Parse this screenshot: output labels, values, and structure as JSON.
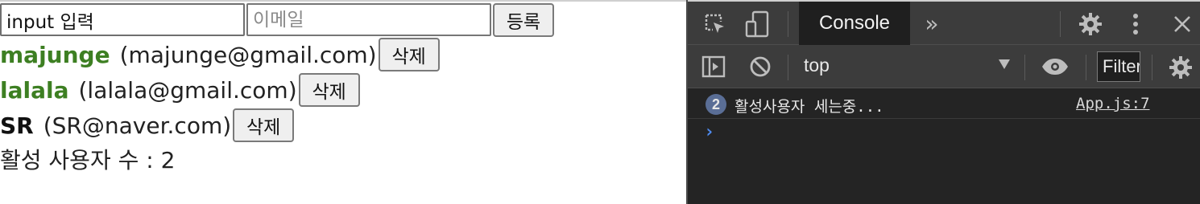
{
  "form": {
    "username_value": "input 입력",
    "email_placeholder": "이메일",
    "email_value": "",
    "register_label": "등록"
  },
  "users": [
    {
      "username": "majunge",
      "email_display": "(majunge@gmail.com)",
      "active": true,
      "delete_label": "삭제"
    },
    {
      "username": "lalala",
      "email_display": "(lalala@gmail.com)",
      "active": true,
      "delete_label": "삭제"
    },
    {
      "username": "SR",
      "email_display": "(SR@naver.com)",
      "active": false,
      "delete_label": "삭제"
    }
  ],
  "active_count": {
    "label": "활성 사용자 수 : ",
    "value": "2"
  },
  "devtools": {
    "tabs": {
      "console": "Console",
      "more": "»"
    },
    "context": "top",
    "filter_placeholder": "Filter",
    "log": {
      "count": "2",
      "message": "활성사용자 세는중...",
      "source": "App.js:7"
    },
    "prompt": "›",
    "icons": {
      "inspect": "inspect-element-icon",
      "device": "device-toolbar-icon",
      "settings": "gear-icon",
      "kebab": "more-vertical-icon",
      "close": "close-icon",
      "sidebar": "sidebar-toggle-icon",
      "clear": "clear-console-icon",
      "eye": "live-expression-eye-icon"
    }
  },
  "colors": {
    "active_user": "#3d7f22",
    "devtools_bg": "#242424",
    "devtools_toolbar": "#3c3c3c",
    "badge": "#5a6e96",
    "prompt": "#4f8bf0"
  }
}
